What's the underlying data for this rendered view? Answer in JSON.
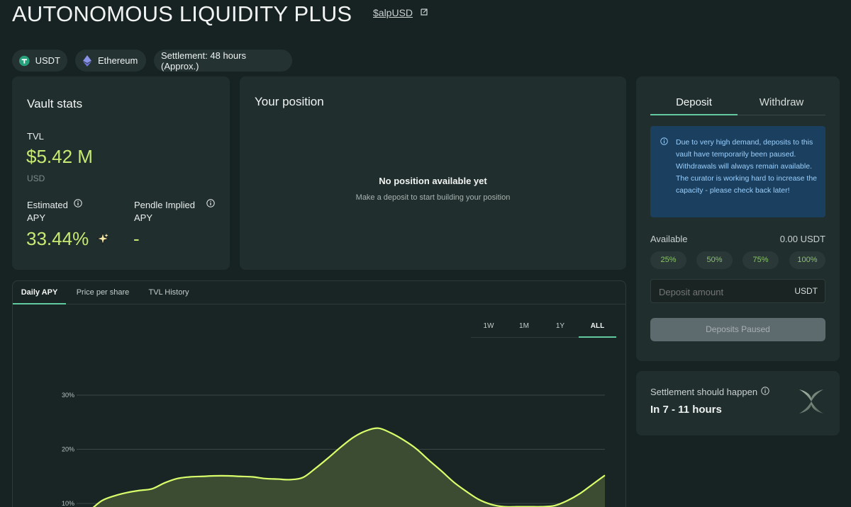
{
  "header": {
    "title": "AUTONOMOUS LIQUIDITY PLUS",
    "token_link": "$alpUSD"
  },
  "chips": {
    "asset": "USDT",
    "network": "Ethereum",
    "settlement": "Settlement: 48 hours (Approx.)"
  },
  "vault_stats": {
    "title": "Vault stats",
    "tvl_label": "TVL",
    "tvl_value": "$5.42 M",
    "tvl_unit": "USD",
    "est_apy_label_1": "Estimated",
    "est_apy_label_2": "APY",
    "est_apy_value": "33.44%",
    "pendle_label_1": "Pendle Implied",
    "pendle_label_2": "APY",
    "pendle_value": "-"
  },
  "position": {
    "title": "Your position",
    "empty_title": "No position available yet",
    "empty_subtitle": "Make a deposit to start building your position"
  },
  "chart_tabs": [
    "Daily APY",
    "Price per share",
    "TVL History"
  ],
  "ranges": [
    "1W",
    "1M",
    "1Y",
    "ALL"
  ],
  "chart_data": {
    "type": "area",
    "title": "",
    "xlabel": "",
    "ylabel": "",
    "y_ticks": [
      "30%",
      "20%",
      "10%"
    ],
    "ylim": [
      0,
      30
    ],
    "grid": true,
    "x": [
      0,
      1,
      2,
      3,
      4,
      5,
      6,
      7,
      8,
      9,
      10,
      11,
      12,
      13,
      14,
      15,
      16,
      17,
      18,
      19,
      20,
      21,
      22,
      23,
      24,
      25,
      26,
      27,
      28,
      29,
      30,
      31,
      32,
      33,
      34,
      35,
      36,
      37,
      38,
      39
    ],
    "values": [
      7.7,
      8.7,
      10.5,
      11.4,
      12.0,
      12.4,
      12.7,
      13.8,
      14.6,
      14.9,
      15.0,
      15.1,
      15.1,
      15.0,
      14.9,
      14.6,
      14.5,
      14.4,
      14.8,
      16.5,
      18.4,
      20.4,
      22.2,
      23.4,
      23.9,
      23.0,
      21.7,
      20.1,
      18.0,
      16.0,
      13.9,
      12.2,
      10.7,
      9.8,
      9.4,
      9.4,
      9.4,
      9.4,
      9.6,
      10.5,
      11.8,
      13.5,
      15.2
    ],
    "line_color": "#d8ff6b",
    "fill_color": "#3b4c32"
  },
  "sidebar": {
    "tab_deposit": "Deposit",
    "tab_withdraw": "Withdraw",
    "notice": "Due to very high demand, deposits to this vault have temporarily been paused. Withdrawals will always remain available. The curator is working hard to increase the capacity - please check back later!",
    "available_label": "Available",
    "available_value": "0.00 USDT",
    "pct_buttons": [
      "25%",
      "50%",
      "75%",
      "100%"
    ],
    "amount_placeholder": "Deposit amount",
    "amount_unit": "USDT",
    "submit_label": "Deposits Paused"
  },
  "settlement_card": {
    "title": "Settlement should happen",
    "value": "In 7 - 11 hours"
  },
  "colors": {
    "accent_green": "#c6ea72",
    "tab_underline": "#62c8a0",
    "notice_bg": "#1b3f5e"
  }
}
